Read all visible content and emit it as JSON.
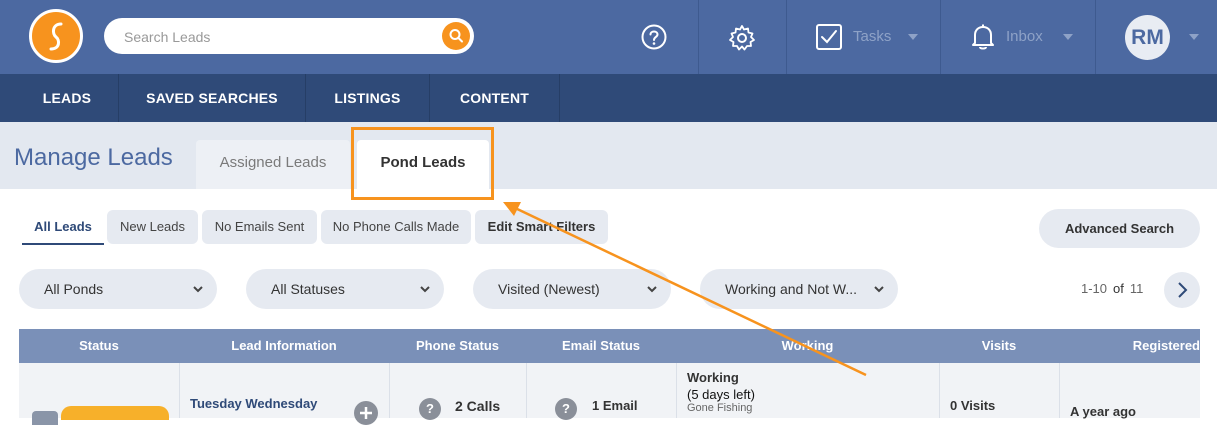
{
  "header": {
    "search": {
      "placeholder": "Search Leads"
    },
    "tasks_label": "Tasks",
    "inbox_label": "Inbox",
    "avatar_initials": "RM",
    "brand_color": "#4c69a1",
    "accent_color": "#f7931e",
    "icons": [
      "logo",
      "search-icon",
      "help-icon",
      "gear-icon",
      "tasks-checkbox-icon",
      "bell-icon"
    ]
  },
  "menu": {
    "items": [
      {
        "label": "LEADS"
      },
      {
        "label": "SAVED SEARCHES"
      },
      {
        "label": "LISTINGS"
      },
      {
        "label": "CONTENT"
      }
    ]
  },
  "page": {
    "title": "Manage Leads",
    "tabs": [
      {
        "label": "Assigned Leads",
        "active": false
      },
      {
        "label": "Pond Leads",
        "active": true
      }
    ]
  },
  "quick_filters": [
    {
      "label": "All Leads",
      "active": true
    },
    {
      "label": "New Leads"
    },
    {
      "label": "No Emails Sent"
    },
    {
      "label": "No Phone Calls Made"
    },
    {
      "label": "Edit Smart Filters"
    }
  ],
  "advanced_search_label": "Advanced Search",
  "dropdowns": [
    {
      "value": "All Ponds"
    },
    {
      "value": "All Statuses"
    },
    {
      "value": "Visited (Newest)"
    },
    {
      "value": "Working and Not W..."
    }
  ],
  "pagination": {
    "range": "1-10",
    "of_label": "of",
    "total": "11"
  },
  "table": {
    "columns": [
      "Status",
      "Lead Information",
      "Phone Status",
      "Email Status",
      "Working",
      "Visits",
      "Registered"
    ],
    "row": {
      "lead_name": "Tuesday Wednesday",
      "calls": "2 Calls",
      "email": "1 Email",
      "working_title": "Working",
      "working_days": "(5 days left)",
      "working_by": "Gone Fishing",
      "visits": "0 Visits",
      "registered": "A year ago"
    }
  }
}
